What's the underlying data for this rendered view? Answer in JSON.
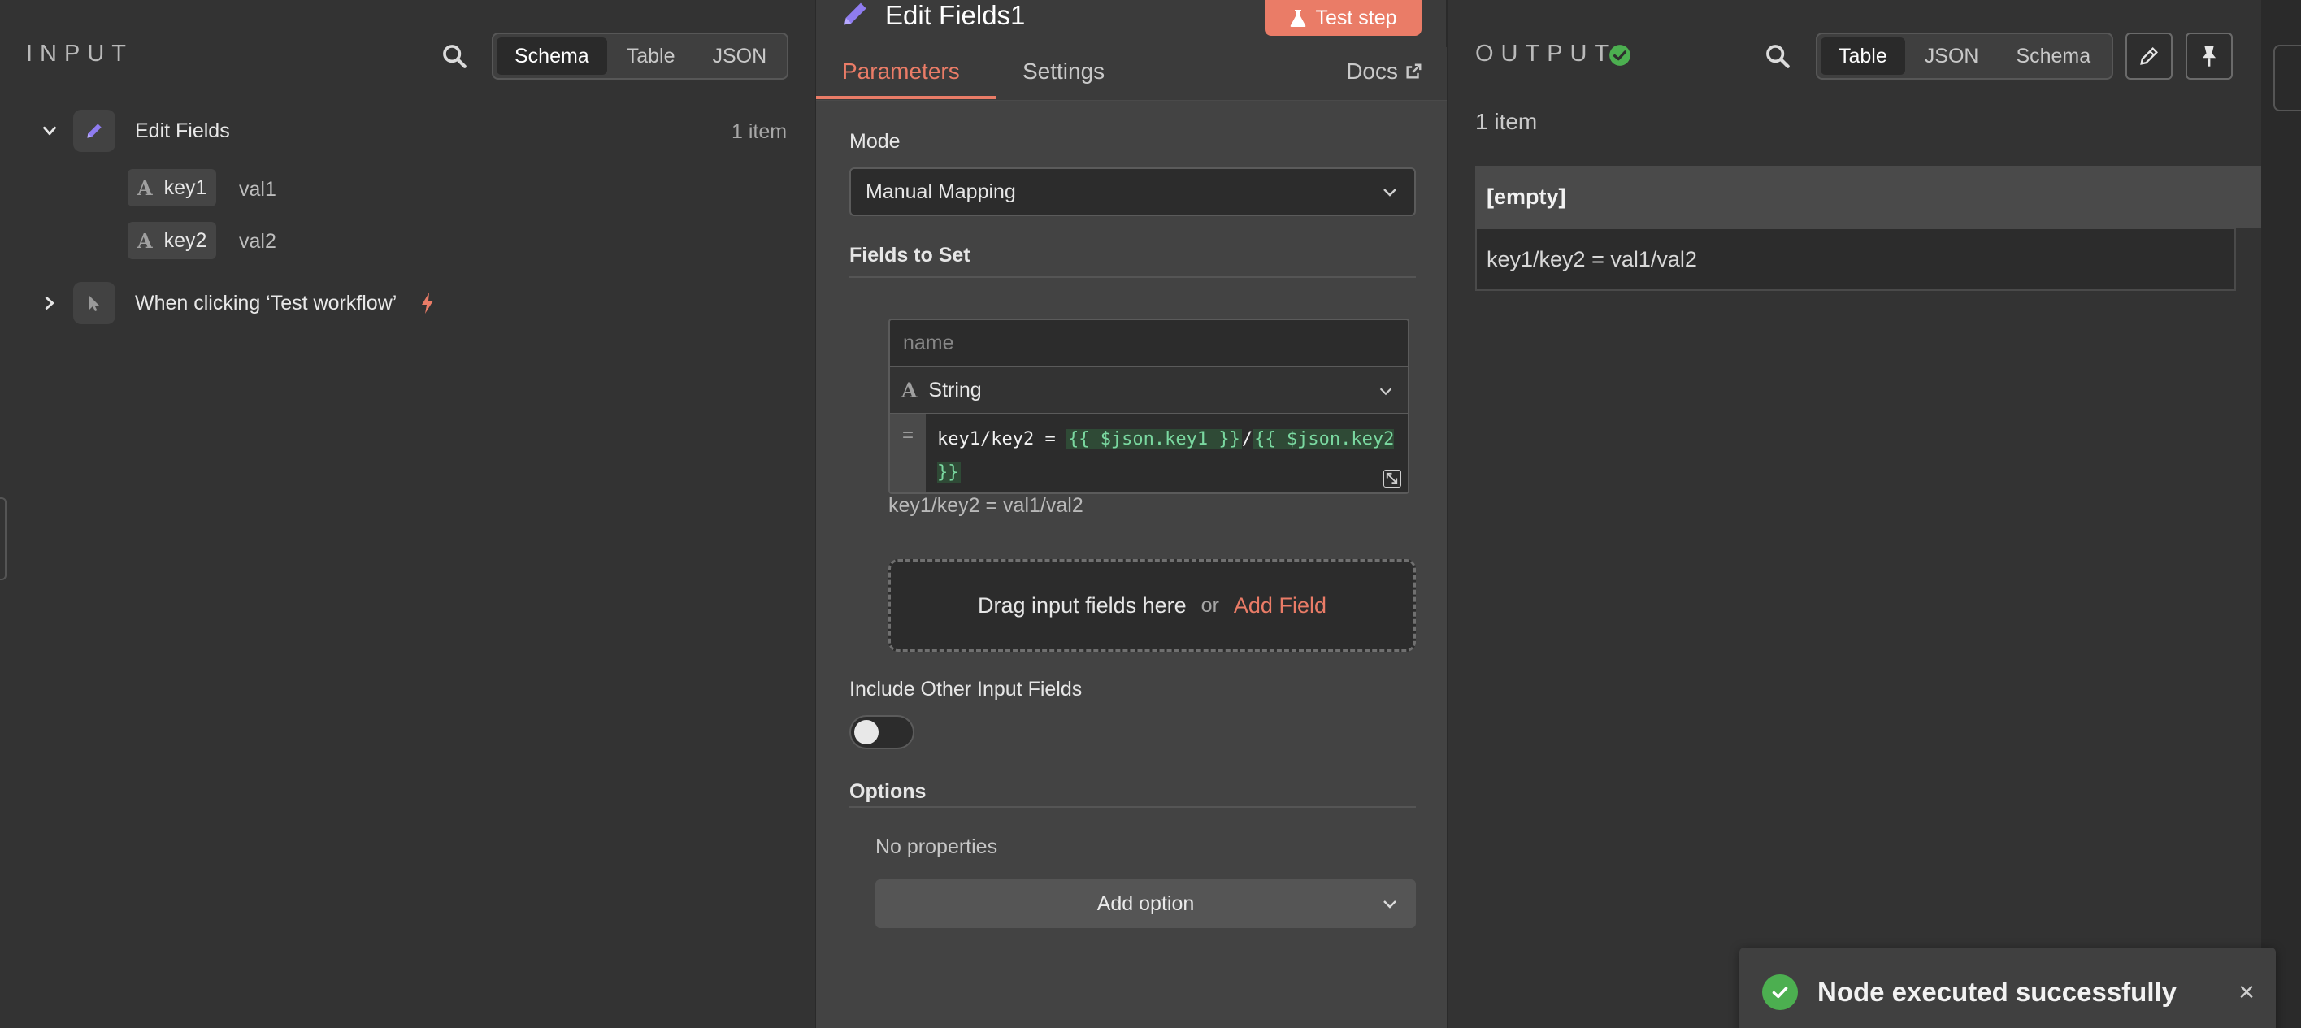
{
  "input": {
    "title": "INPUT",
    "views": [
      "Schema",
      "Table",
      "JSON"
    ],
    "active_view": "Schema",
    "tree": [
      {
        "label": "Edit Fields",
        "count": "1 item",
        "icon": "pencil-icon",
        "expanded": true
      },
      {
        "label": "When clicking ‘Test workflow’",
        "icon": "cursor-icon",
        "expanded": false
      }
    ],
    "fields": [
      {
        "type_glyph": "A",
        "name": "key1",
        "value": "val1"
      },
      {
        "type_glyph": "A",
        "name": "key2",
        "value": "val2"
      }
    ]
  },
  "params": {
    "node_title": "Edit Fields1",
    "test_step_label": "Test step",
    "tabs": [
      "Parameters",
      "Settings"
    ],
    "active_tab": "Parameters",
    "docs_label": "Docs",
    "mode_label": "Mode",
    "mode_value": "Manual Mapping",
    "fields_to_set_label": "Fields to Set",
    "assignment": {
      "name_placeholder": "name",
      "type_glyph": "A",
      "type_value": "String",
      "eq_sign": "=",
      "expr_prefix": "key1/key2 = ",
      "expr_part1": "{{ $json.key1 }}",
      "expr_sep": "/",
      "expr_part2": "{{ $json.key2 }}",
      "result": "key1/key2 = val1/val2"
    },
    "drop_text": "Drag input fields here",
    "drop_or": "or",
    "add_field_label": "Add Field",
    "include_label": "Include Other Input Fields",
    "include_enabled": false,
    "options_label": "Options",
    "no_properties": "No properties",
    "add_option_label": "Add option"
  },
  "output": {
    "title": "OUTPUT",
    "views": [
      "Table",
      "JSON",
      "Schema"
    ],
    "active_view": "Table",
    "items_count": "1 item",
    "table_header": "[empty]",
    "table_rows": [
      "key1/key2 = val1/val2"
    ]
  },
  "toast": {
    "message": "Node executed successfully",
    "close_glyph": "×"
  },
  "colors": {
    "accent": "#ea7c67",
    "success": "#4caf50",
    "expr_highlight": "#7ad8a0"
  }
}
